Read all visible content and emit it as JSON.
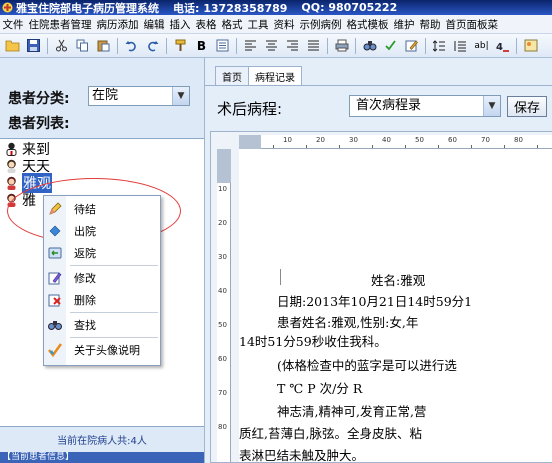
{
  "titlebar": {
    "app_name": "雅宝住院部电子病历管理系统",
    "phone": "电话: 13728358789",
    "qq": "QQ: 980705222"
  },
  "menu": [
    "文件",
    "住院患者管理",
    "病历添加",
    "编辑",
    "插入",
    "表格",
    "格式",
    "工具",
    "资料",
    "示例病例",
    "格式模板",
    "维护",
    "帮助",
    "首页面板菜"
  ],
  "toolbar_icons": [
    "folder-open-icon",
    "save-icon",
    "cut-icon",
    "copy-icon",
    "paste-icon",
    "undo-icon",
    "redo-icon",
    "format-painter-icon",
    "bold-icon",
    "indent-icon",
    "align-left-icon",
    "align-center-icon",
    "align-right-icon",
    "justify-icon",
    "print-icon",
    "find-icon",
    "spellcheck-icon",
    "edit-icon",
    "line-spacing-icon",
    "paragraph-icon",
    "field-icon",
    "special-char-icon",
    "image-icon"
  ],
  "left": {
    "category_label": "患者分类:",
    "category_value": "在院",
    "list_label": "患者列表:",
    "patients": [
      {
        "name": "来到",
        "icon": "doctor-avatar-icon"
      },
      {
        "name": "天天",
        "icon": "female-avatar-icon"
      },
      {
        "name": "雅观",
        "icon": "female-avatar-icon"
      },
      {
        "name": "雅",
        "icon": "female-avatar-icon"
      }
    ],
    "count_text": "当前在院病人共:4人",
    "current_info": "【当前患者信息】"
  },
  "context_menu": [
    {
      "label": "待结",
      "icon": "pencil-icon"
    },
    {
      "label": "出院",
      "icon": "diamond-icon"
    },
    {
      "label": "返院",
      "icon": "return-icon"
    },
    {
      "label": "修改",
      "icon": "edit-icon"
    },
    {
      "label": "删除",
      "icon": "delete-icon"
    },
    {
      "label": "查找",
      "icon": "binoculars-icon"
    },
    {
      "label": "关于头像说明",
      "icon": "checkmark-icon"
    }
  ],
  "right": {
    "tabs": [
      "首页",
      "病程记录"
    ],
    "active_tab": "病程记录",
    "section_title": "术后病程:",
    "record_type": "首次病程录",
    "save_label": "保存",
    "ruler_h": [
      "10",
      "20",
      "30",
      "40",
      "50",
      "60",
      "70",
      "80"
    ],
    "ruler_v": [
      "10",
      "20",
      "30",
      "40",
      "50",
      "60",
      "70",
      "80"
    ],
    "document": {
      "name_line": "姓名:雅观",
      "date_line": "日期:2013年10月21日14时59分1",
      "intro_line1": "患者姓名:雅观,性别:女,年",
      "intro_line2": "14时51分59秒收住我科。",
      "note_line": "(体格检查中的蓝字是可以进行选",
      "vitals_line": "T  ℃        P 次/分        R",
      "exam_line1": "神志清,精神可,发育正常,营",
      "exam_line2": "质红,苔薄白,脉弦。全身皮肤、粘",
      "exam_line3": "表淋巴结未触及肿大。"
    }
  }
}
